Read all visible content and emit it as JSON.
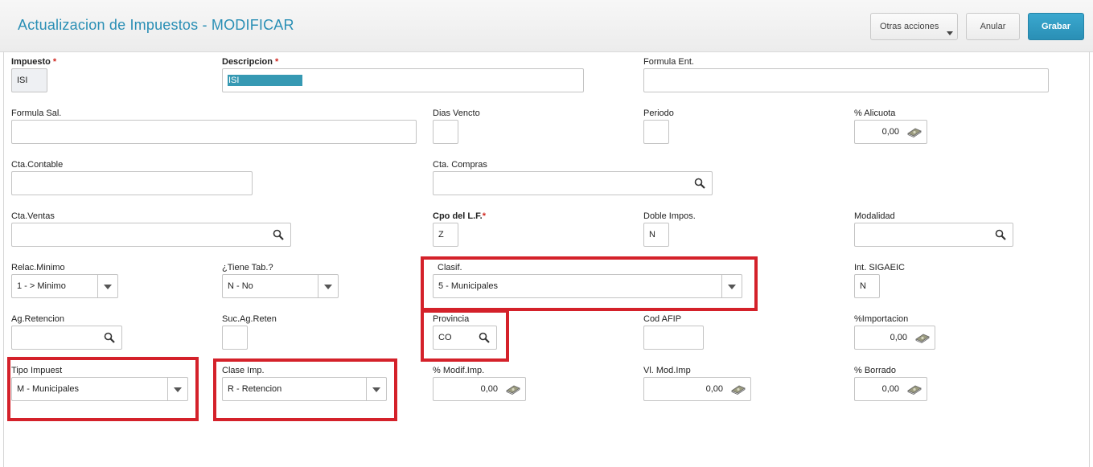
{
  "header": {
    "title": "Actualizacion de Impuestos - MODIFICAR",
    "otras_acciones": "Otras acciones",
    "anular": "Anular",
    "grabar": "Grabar"
  },
  "colors": {
    "accent": "#2a8fb5",
    "highlight": "#d4212a"
  },
  "fields": {
    "impuesto": {
      "label": "Impuesto",
      "value": "ISI",
      "required": "*"
    },
    "descripcion": {
      "label": "Descripcion",
      "value": "ISI",
      "required": "*"
    },
    "formula_ent": {
      "label": "Formula Ent.",
      "value": ""
    },
    "formula_sal": {
      "label": "Formula Sal.",
      "value": ""
    },
    "dias_vencto": {
      "label": "Dias Vencto",
      "value": ""
    },
    "periodo": {
      "label": "Periodo",
      "value": ""
    },
    "alicuota": {
      "label": "% Alicuota",
      "value": "0,00"
    },
    "cta_contable": {
      "label": "Cta.Contable",
      "value": ""
    },
    "cta_compras": {
      "label": "Cta. Compras",
      "value": ""
    },
    "cta_ventas": {
      "label": "Cta.Ventas",
      "value": ""
    },
    "cpo_lf": {
      "label": "Cpo del L.F.",
      "value": "Z",
      "required": "*"
    },
    "doble_impos": {
      "label": "Doble Impos.",
      "value": "N"
    },
    "modalidad": {
      "label": "Modalidad",
      "value": ""
    },
    "relac_minimo": {
      "label": "Relac.Minimo",
      "value": "1 -  > Minimo"
    },
    "tiene_tab": {
      "label": "¿Tiene Tab.?",
      "value": "N -  No"
    },
    "clasif": {
      "label": "Clasif.",
      "value": "5 - Municipales"
    },
    "int_sigaeic": {
      "label": "Int. SIGAEIC",
      "value": "N"
    },
    "ag_retencion": {
      "label": "Ag.Retencion",
      "value": ""
    },
    "suc_ag_reten": {
      "label": "Suc.Ag.Reten",
      "value": ""
    },
    "provincia": {
      "label": "Provincia",
      "value": "CO"
    },
    "cod_afip": {
      "label": "Cod AFIP",
      "value": ""
    },
    "importacion": {
      "label": "%Importacion",
      "value": "0,00"
    },
    "tipo_impuest": {
      "label": "Tipo Impuest",
      "value": "M - Municipales"
    },
    "clase_imp": {
      "label": "Clase Imp.",
      "value": "R - Retencion"
    },
    "modif_imp": {
      "label": "% Modif.Imp.",
      "value": "0,00"
    },
    "vl_mod_imp": {
      "label": "Vl. Mod.Imp",
      "value": "0,00"
    },
    "borrado": {
      "label": "% Borrado",
      "value": "0,00"
    }
  }
}
